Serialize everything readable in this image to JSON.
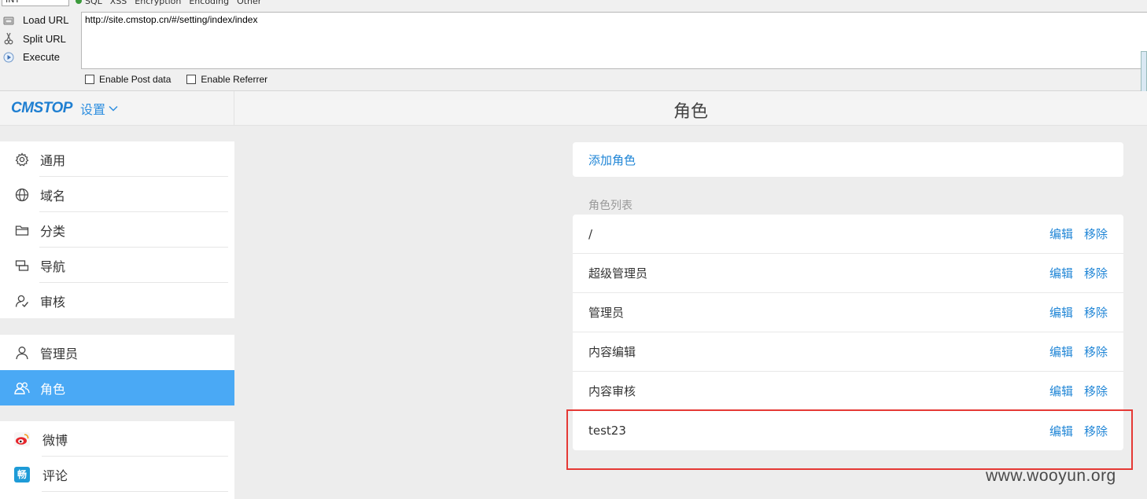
{
  "hackbar": {
    "select_value": "INT",
    "menu": [
      "SQL",
      "XSS",
      "Encryption",
      "Encoding",
      "Other"
    ],
    "actions": [
      {
        "label": "Load URL",
        "icon": "load-url-icon"
      },
      {
        "label": "Split URL",
        "icon": "scissors-icon"
      },
      {
        "label": "Execute",
        "icon": "play-icon"
      }
    ],
    "url": "http://site.cmstop.cn/#/setting/index/index",
    "checks": [
      "Enable Post data",
      "Enable Referrer"
    ]
  },
  "header": {
    "logo": "CMSTOP",
    "settings_label": "设置",
    "page_title": "角色"
  },
  "sidebar": {
    "group1": [
      {
        "label": "通用",
        "icon": "gear-icon"
      },
      {
        "label": "域名",
        "icon": "globe-icon"
      },
      {
        "label": "分类",
        "icon": "folder-icon"
      },
      {
        "label": "导航",
        "icon": "navigation-icon"
      },
      {
        "label": "审核",
        "icon": "review-icon"
      }
    ],
    "group2": [
      {
        "label": "管理员",
        "icon": "user-icon"
      },
      {
        "label": "角色",
        "icon": "role-icon"
      }
    ],
    "group3": [
      {
        "label": "微博",
        "icon": "weibo-icon"
      },
      {
        "label": "评论",
        "icon": "comment-icon",
        "icon_glyph": "畅"
      }
    ],
    "active": "角色"
  },
  "main": {
    "add_role": "添加角色",
    "list_title": "角色列表",
    "edit_label": "编辑",
    "remove_label": "移除",
    "roles": [
      "/",
      "超级管理员",
      "管理员",
      "内容编辑",
      "内容审核",
      "test23"
    ]
  },
  "watermark": "www.wooyun.org",
  "colors": {
    "accent": "#1f85d6",
    "active_bg": "#4aa9f5",
    "highlight": "#e53935"
  }
}
